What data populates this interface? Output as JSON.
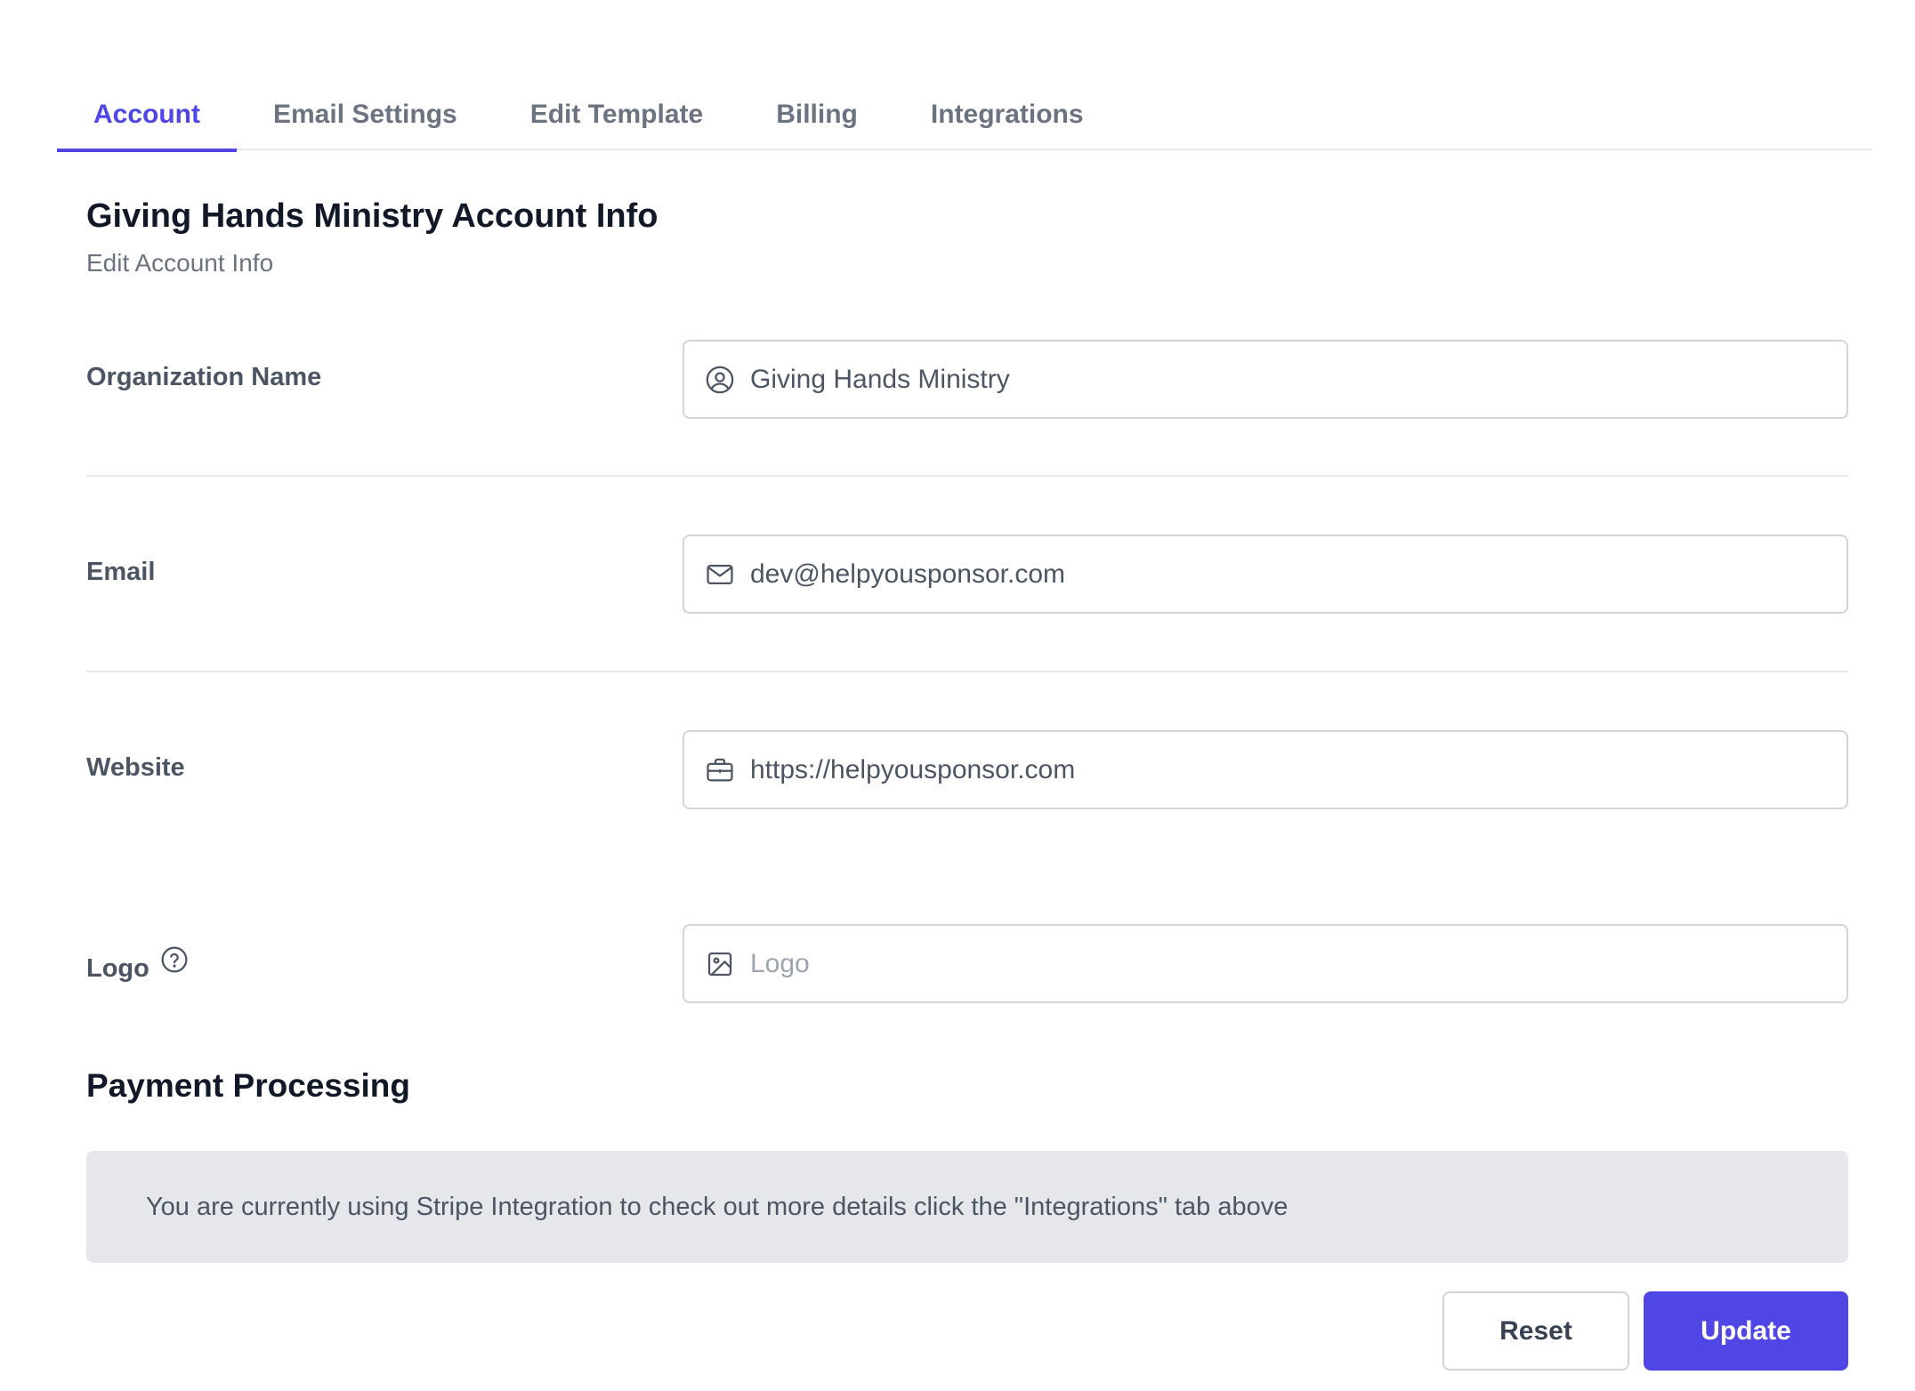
{
  "tabs": [
    {
      "label": "Account",
      "active": true
    },
    {
      "label": "Email Settings",
      "active": false
    },
    {
      "label": "Edit Template",
      "active": false
    },
    {
      "label": "Billing",
      "active": false
    },
    {
      "label": "Integrations",
      "active": false
    }
  ],
  "header": {
    "title": "Giving Hands Ministry Account Info",
    "subtitle": "Edit Account Info"
  },
  "form": {
    "organization_name": {
      "label": "Organization Name",
      "value": "Giving Hands Ministry",
      "icon": "user-circle-icon"
    },
    "email": {
      "label": "Email",
      "value": "dev@helpyousponsor.com",
      "icon": "envelope-icon"
    },
    "website": {
      "label": "Website",
      "value": "https://helpyousponsor.com",
      "icon": "briefcase-icon"
    },
    "logo": {
      "label": "Logo",
      "value": "",
      "placeholder": "Logo",
      "icon": "image-icon",
      "help_icon": "question-circle-icon"
    }
  },
  "payment": {
    "title": "Payment Processing",
    "notice": "You are currently using Stripe Integration to check out more details click the \"Integrations\" tab above"
  },
  "actions": {
    "reset_label": "Reset",
    "update_label": "Update"
  },
  "colors": {
    "accent": "#4f46e5",
    "text_muted": "#6b7280",
    "border": "#d1d5db",
    "notice_bg": "#e5e7eb"
  }
}
